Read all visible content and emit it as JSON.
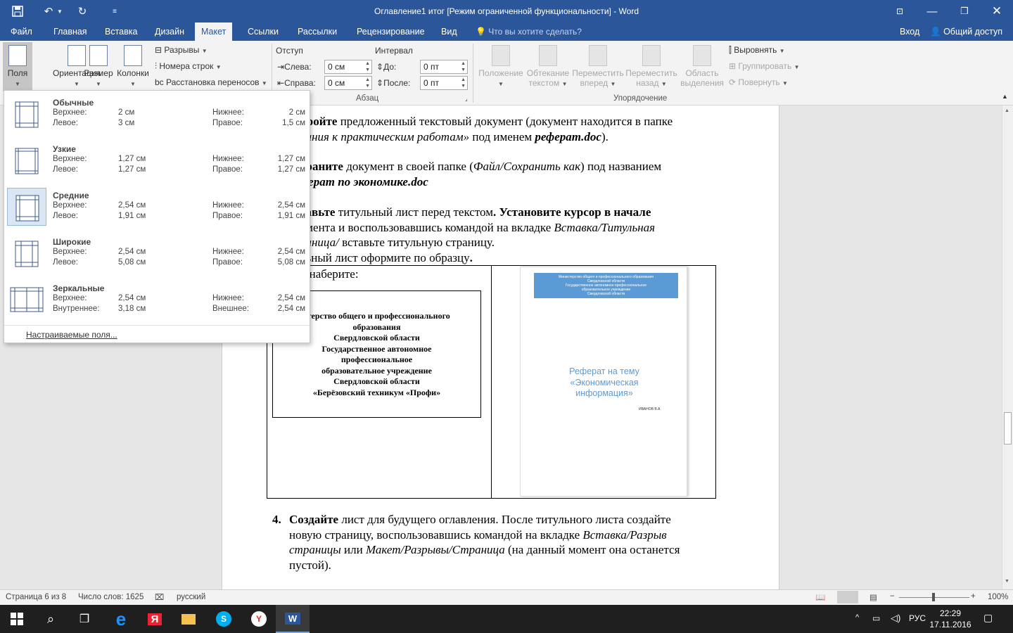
{
  "window": {
    "title": "Оглавление1 итог [Режим ограниченной функциональности] - Word"
  },
  "tabs": [
    {
      "label": "Файл"
    },
    {
      "label": "Главная"
    },
    {
      "label": "Вставка"
    },
    {
      "label": "Дизайн"
    },
    {
      "label": "Макет"
    },
    {
      "label": "Ссылки"
    },
    {
      "label": "Рассылки"
    },
    {
      "label": "Рецензирование"
    },
    {
      "label": "Вид"
    }
  ],
  "tell_me": "Что вы хотите сделать?",
  "signin": "Вход",
  "share": "Общий доступ",
  "ribbon": {
    "margins": "Поля",
    "orientation": "Ориентация",
    "size": "Размер",
    "columns": "Колонки",
    "breaks": "Разрывы",
    "line_numbers": "Номера строк",
    "hyphenation": "Расстановка переносов",
    "indent_label": "Отступ",
    "spacing_label": "Интервал",
    "left_label": "Слева:",
    "right_label": "Справа:",
    "before_label": "До:",
    "after_label": "После:",
    "left_value": "0 см",
    "right_value": "0 см",
    "before_value": "0 пт",
    "after_value": "0 пт",
    "paragraph_group": "Абзац",
    "position": "Положение",
    "wrap_text_1": "Обтекание",
    "wrap_text_2": "текстом",
    "bring_forward_1": "Переместить",
    "bring_forward_2": "вперед",
    "send_backward_1": "Переместить",
    "send_backward_2": "назад",
    "selection_pane_1": "Область",
    "selection_pane_2": "выделения",
    "align": "Выровнять",
    "group": "Группировать",
    "rotate": "Повернуть",
    "arrange_group": "Упорядочение"
  },
  "margins_menu": {
    "presets": [
      {
        "name": "Обычные",
        "l1": "Верхнее:",
        "v1": "2 см",
        "l2": "Нижнее:",
        "v2": "2 см",
        "l3": "Левое:",
        "v3": "3 см",
        "l4": "Правое:",
        "v4": "1,5 см"
      },
      {
        "name": "Узкие",
        "l1": "Верхнее:",
        "v1": "1,27 см",
        "l2": "Нижнее:",
        "v2": "1,27 см",
        "l3": "Левое:",
        "v3": "1,27 см",
        "l4": "Правое:",
        "v4": "1,27 см"
      },
      {
        "name": "Средние",
        "l1": "Верхнее:",
        "v1": "2,54 см",
        "l2": "Нижнее:",
        "v2": "2,54 см",
        "l3": "Левое:",
        "v3": "1,91 см",
        "l4": "Правое:",
        "v4": "1,91 см"
      },
      {
        "name": "Широкие",
        "l1": "Верхнее:",
        "v1": "2,54 см",
        "l2": "Нижнее:",
        "v2": "2,54 см",
        "l3": "Левое:",
        "v3": "5,08 см",
        "l4": "Правое:",
        "v4": "5,08 см"
      },
      {
        "name": "Зеркальные",
        "l1": "Верхнее:",
        "v1": "2,54 см",
        "l2": "Нижнее:",
        "v2": "2,54 см",
        "l3": "Внутреннее:",
        "v3": "3,18 см",
        "l4": "Внешнее:",
        "v4": "2,54 см"
      }
    ],
    "custom": "Настраиваемые поля..."
  },
  "document": {
    "p1_a": "кройте",
    "p1_b": " предложенный текстовый документ (документ находится в папке",
    "p1_c": "дания к практическим работам»",
    "p1_d": " под именем ",
    "p1_e": "реферат.doc",
    "p1_f": ").",
    "p2_a": "храните",
    "p2_b": " документ в своей папке (",
    "p2_c": "Файл/Сохранить как",
    "p2_d": ") под названием",
    "p2_e": "ферат по экономике.doc",
    "p3_a": "тавьте",
    "p3_b": " титульный лист перед текстом",
    "p3_c": ". Установите курсор в начале",
    "p3_d": "умента и воспользовавшись командой на вкладке ",
    "p3_e": "Вставка/Титульная",
    "p3_f": "раница/",
    "p3_g": " вставьте титульную страницу.",
    "p3_h": "льный лист оформите по образцу",
    "p3_i": ".",
    "table_text": "ке наберите:",
    "box_lines": [
      "стерство общего и профессионального",
      "образования",
      "Свердловской области",
      "Государственное автономное",
      "профессиональное",
      "образовательное учреждение",
      "Свердловской области",
      "«Берёзовский техникум «Профи»"
    ],
    "thumb_header_lines": [
      "Министерство общего и профессионального образования",
      "Свердловской области",
      "Государственное автономное профессиональное",
      "образовательное учреждение",
      "Свердловской области"
    ],
    "thumb_title_1": "Реферат на тему",
    "thumb_title_2": "«Экономическая",
    "thumb_title_3": "информация»",
    "thumb_author": "ИВАНОВ В.А.",
    "p4_num": "4.",
    "p4_a": "Создайте",
    "p4_b": " лист для будущего оглавления. После титульного листа создайте",
    "p4_c": "новую страницу, воспользовавшись командой на вкладке ",
    "p4_d": "Вставка/Разрыв",
    "p4_e": "страницы",
    "p4_f": " или ",
    "p4_g": "Макет/Разрывы/Страница",
    "p4_h": " (на данный момент она останется",
    "p4_i": "пустой)."
  },
  "status": {
    "page": "Страница 6 из 8",
    "words": "Число слов: 1625",
    "language": "русский",
    "zoom": "100%"
  },
  "taskbar": {
    "lang": "РУС",
    "time": "22:29",
    "date": "17.11.2016"
  },
  "colors": {
    "accent": "#2b579a",
    "thumb_blue": "#5b9bd5"
  }
}
